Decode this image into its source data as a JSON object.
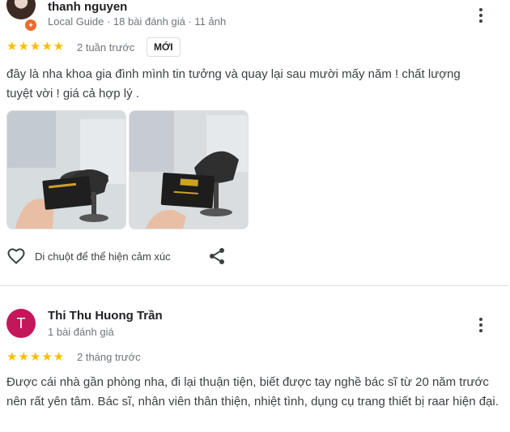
{
  "review1": {
    "author": "thanh nguyen",
    "meta": "Local Guide · 18 bài đánh giá · 11 ảnh",
    "stars": "★★★★★",
    "time": "2 tuần trước",
    "badge": "MỚI",
    "text": "đây là nha khoa gia đình mình tin tưởng và quay lại sau mười mấy năm ! chất lượng tuyệt vời ! giá cả hợp lý .",
    "reaction_hint": "Di chuột để thể hiện cảm xúc"
  },
  "review2": {
    "avatar_letter": "T",
    "author": "Thi Thu Huong Trần",
    "meta": "1 bài đánh giá",
    "stars": "★★★★★",
    "time": "2 tháng trước",
    "text": "Được cái nhà gần phòng nha, đi lại thuận tiện, biết được tay nghề bác sĩ từ 20 năm trước nên rất yên tâm. Bác sĩ, nhân viên thân thiện, nhiệt tình, dụng cụ trang thiết bị raar hiện đại."
  },
  "icons": {
    "heart": "heart-icon",
    "share": "share-icon",
    "more": "more-vert-icon"
  },
  "colors": {
    "star": "#fbbc04",
    "avatar2_bg": "#c2185b",
    "guide_badge": "#ea6b2e"
  }
}
